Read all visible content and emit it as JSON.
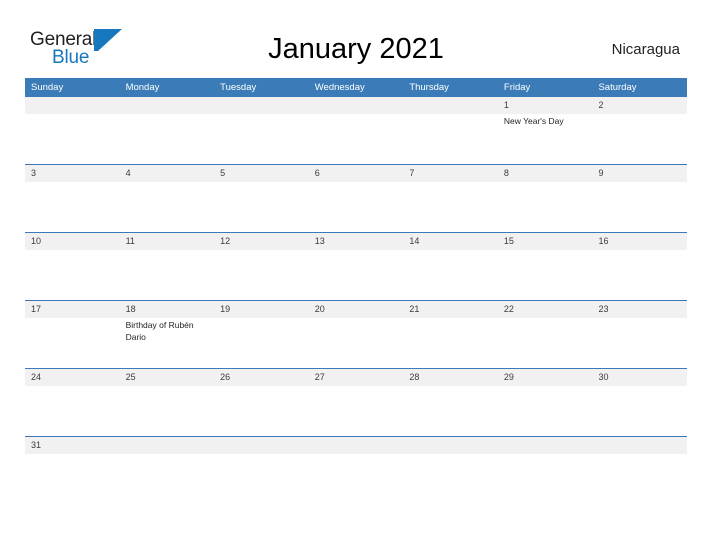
{
  "brand": {
    "name_part1": "General",
    "name_part2": "Blue",
    "accent_color": "#1878be"
  },
  "header": {
    "title": "January 2021",
    "locale": "Nicaragua"
  },
  "calendar": {
    "header_color": "#3b7cb8",
    "band_color": "#f1f1f1",
    "weekdays": [
      "Sunday",
      "Monday",
      "Tuesday",
      "Wednesday",
      "Thursday",
      "Friday",
      "Saturday"
    ],
    "weeks": [
      {
        "days": [
          {
            "num": "",
            "event": ""
          },
          {
            "num": "",
            "event": ""
          },
          {
            "num": "",
            "event": ""
          },
          {
            "num": "",
            "event": ""
          },
          {
            "num": "",
            "event": ""
          },
          {
            "num": "1",
            "event": "New Year's Day"
          },
          {
            "num": "2",
            "event": ""
          }
        ]
      },
      {
        "days": [
          {
            "num": "3",
            "event": ""
          },
          {
            "num": "4",
            "event": ""
          },
          {
            "num": "5",
            "event": ""
          },
          {
            "num": "6",
            "event": ""
          },
          {
            "num": "7",
            "event": ""
          },
          {
            "num": "8",
            "event": ""
          },
          {
            "num": "9",
            "event": ""
          }
        ]
      },
      {
        "days": [
          {
            "num": "10",
            "event": ""
          },
          {
            "num": "11",
            "event": ""
          },
          {
            "num": "12",
            "event": ""
          },
          {
            "num": "13",
            "event": ""
          },
          {
            "num": "14",
            "event": ""
          },
          {
            "num": "15",
            "event": ""
          },
          {
            "num": "16",
            "event": ""
          }
        ]
      },
      {
        "days": [
          {
            "num": "17",
            "event": ""
          },
          {
            "num": "18",
            "event": "Birthday of Rubén Dario"
          },
          {
            "num": "19",
            "event": ""
          },
          {
            "num": "20",
            "event": ""
          },
          {
            "num": "21",
            "event": ""
          },
          {
            "num": "22",
            "event": ""
          },
          {
            "num": "23",
            "event": ""
          }
        ]
      },
      {
        "days": [
          {
            "num": "24",
            "event": ""
          },
          {
            "num": "25",
            "event": ""
          },
          {
            "num": "26",
            "event": ""
          },
          {
            "num": "27",
            "event": ""
          },
          {
            "num": "28",
            "event": ""
          },
          {
            "num": "29",
            "event": ""
          },
          {
            "num": "30",
            "event": ""
          }
        ]
      },
      {
        "short": true,
        "days": [
          {
            "num": "31",
            "event": ""
          },
          {
            "num": "",
            "event": ""
          },
          {
            "num": "",
            "event": ""
          },
          {
            "num": "",
            "event": ""
          },
          {
            "num": "",
            "event": ""
          },
          {
            "num": "",
            "event": ""
          },
          {
            "num": "",
            "event": ""
          }
        ]
      }
    ]
  }
}
